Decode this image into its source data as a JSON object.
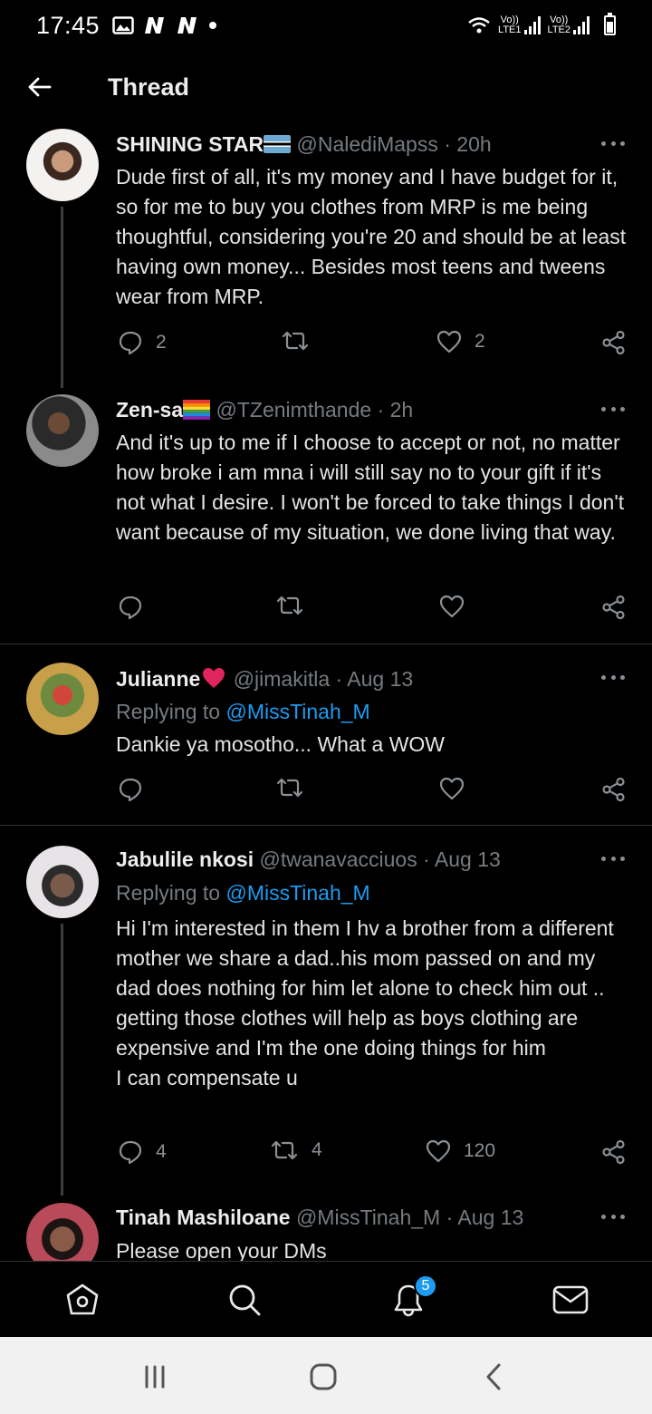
{
  "status_bar": {
    "time": "17:45",
    "sim1": "LTE1",
    "sim2": "LTE2",
    "volte": "Vo))"
  },
  "header": {
    "title": "Thread",
    "back_icon": "arrow-left-icon"
  },
  "tweets": [
    {
      "name": "SHINING STAR",
      "name_emoji": "botswana-flag",
      "handle": "@NalediMapss",
      "time": "20h",
      "replying_label": "",
      "replying_to": "",
      "text": "Dude first of all, it's my money and I have budget for it, so for me to buy you clothes from MRP is me being thoughtful, considering you're 20 and should be at least having own money... Besides most teens and tweens wear from MRP.",
      "replies": "2",
      "retweets": "",
      "likes": "2"
    },
    {
      "name": "Zen-sa",
      "name_emoji": "rainbow-flag",
      "handle": "@TZenimthande",
      "time": "2h",
      "replying_label": "",
      "replying_to": "",
      "text": "And it's up to me if I choose to accept or not, no matter how broke i am mna i will still say no to your gift if it's not what I desire. I won't be forced to take things I don't want because of my situation, we done living that way.",
      "replies": "",
      "retweets": "",
      "likes": ""
    },
    {
      "name": "Julianne",
      "name_emoji": "red-heart",
      "handle": "@jimakitla",
      "time": "Aug 13",
      "replying_label": "Replying to",
      "replying_to": "@MissTinah_M",
      "text": "Dankie ya mosotho... What a WOW",
      "replies": "",
      "retweets": "",
      "likes": ""
    },
    {
      "name": "Jabulile nkosi",
      "name_emoji": "",
      "handle": "@twanavacciuos",
      "time": "Aug 13",
      "replying_label": "Replying to",
      "replying_to": "@MissTinah_M",
      "text": "Hi I'm interested in them I hv a brother from a different mother we share a dad..his mom passed on and my dad does nothing for him let alone to check him out .. getting those clothes will help as boys clothing are expensive and I'm the one doing things for him\nI can compensate u",
      "replies": "4",
      "retweets": "4",
      "likes": "120"
    },
    {
      "name": "Tinah Mashiloane",
      "name_emoji": "",
      "handle": "@MissTinah_M",
      "time": "Aug 13",
      "replying_label": "",
      "replying_to": "",
      "text": "Please open your DMs",
      "replies": "",
      "retweets": "",
      "likes": ""
    }
  ],
  "bottom_nav": {
    "items": [
      "home-icon",
      "search-icon",
      "notifications-icon",
      "messages-icon"
    ],
    "notification_count": "5"
  },
  "system_nav": [
    "recent-apps-icon",
    "home-button-icon",
    "back-icon"
  ],
  "colors": {
    "background": "#000000",
    "accent": "#1d9bf0",
    "muted_text": "#767b80",
    "body_text": "#e4e4e4"
  }
}
